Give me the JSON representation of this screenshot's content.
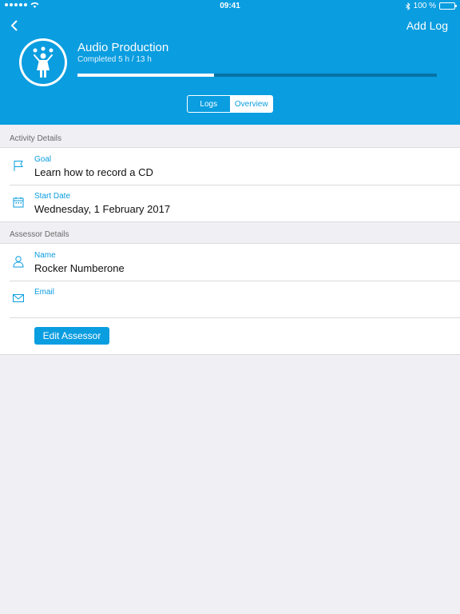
{
  "status_bar": {
    "time": "09:41",
    "battery": "100 %",
    "icons": [
      "signal-dots-icon",
      "wifi-icon",
      "bluetooth-icon",
      "battery-icon"
    ]
  },
  "header": {
    "back_icon": "chevron-left-icon",
    "add_log_label": "Add Log",
    "activity_icon": "juggler-person-icon",
    "title": "Audio Production",
    "subtitle": "Completed 5 h / 13 h",
    "progress_fraction": 0.38,
    "tabs": [
      {
        "label": "Logs",
        "selected": false
      },
      {
        "label": "Overview",
        "selected": true
      }
    ]
  },
  "activity_details": {
    "section_title": "Activity Details",
    "goal": {
      "label": "Goal",
      "value": "Learn how to record a CD",
      "icon": "flag-icon"
    },
    "start_date": {
      "label": "Start Date",
      "value": "Wednesday, 1 February 2017",
      "icon": "calendar-icon"
    }
  },
  "assessor_details": {
    "section_title": "Assessor Details",
    "name": {
      "label": "Name",
      "value": "Rocker Numberone",
      "icon": "person-icon"
    },
    "email": {
      "label": "Email",
      "value": "",
      "icon": "envelope-icon"
    },
    "edit_button_label": "Edit Assessor"
  },
  "colors": {
    "accent": "#0a9de0",
    "background": "#efeff4",
    "progress_track": "#0672a6",
    "battery": "#4cd964"
  }
}
